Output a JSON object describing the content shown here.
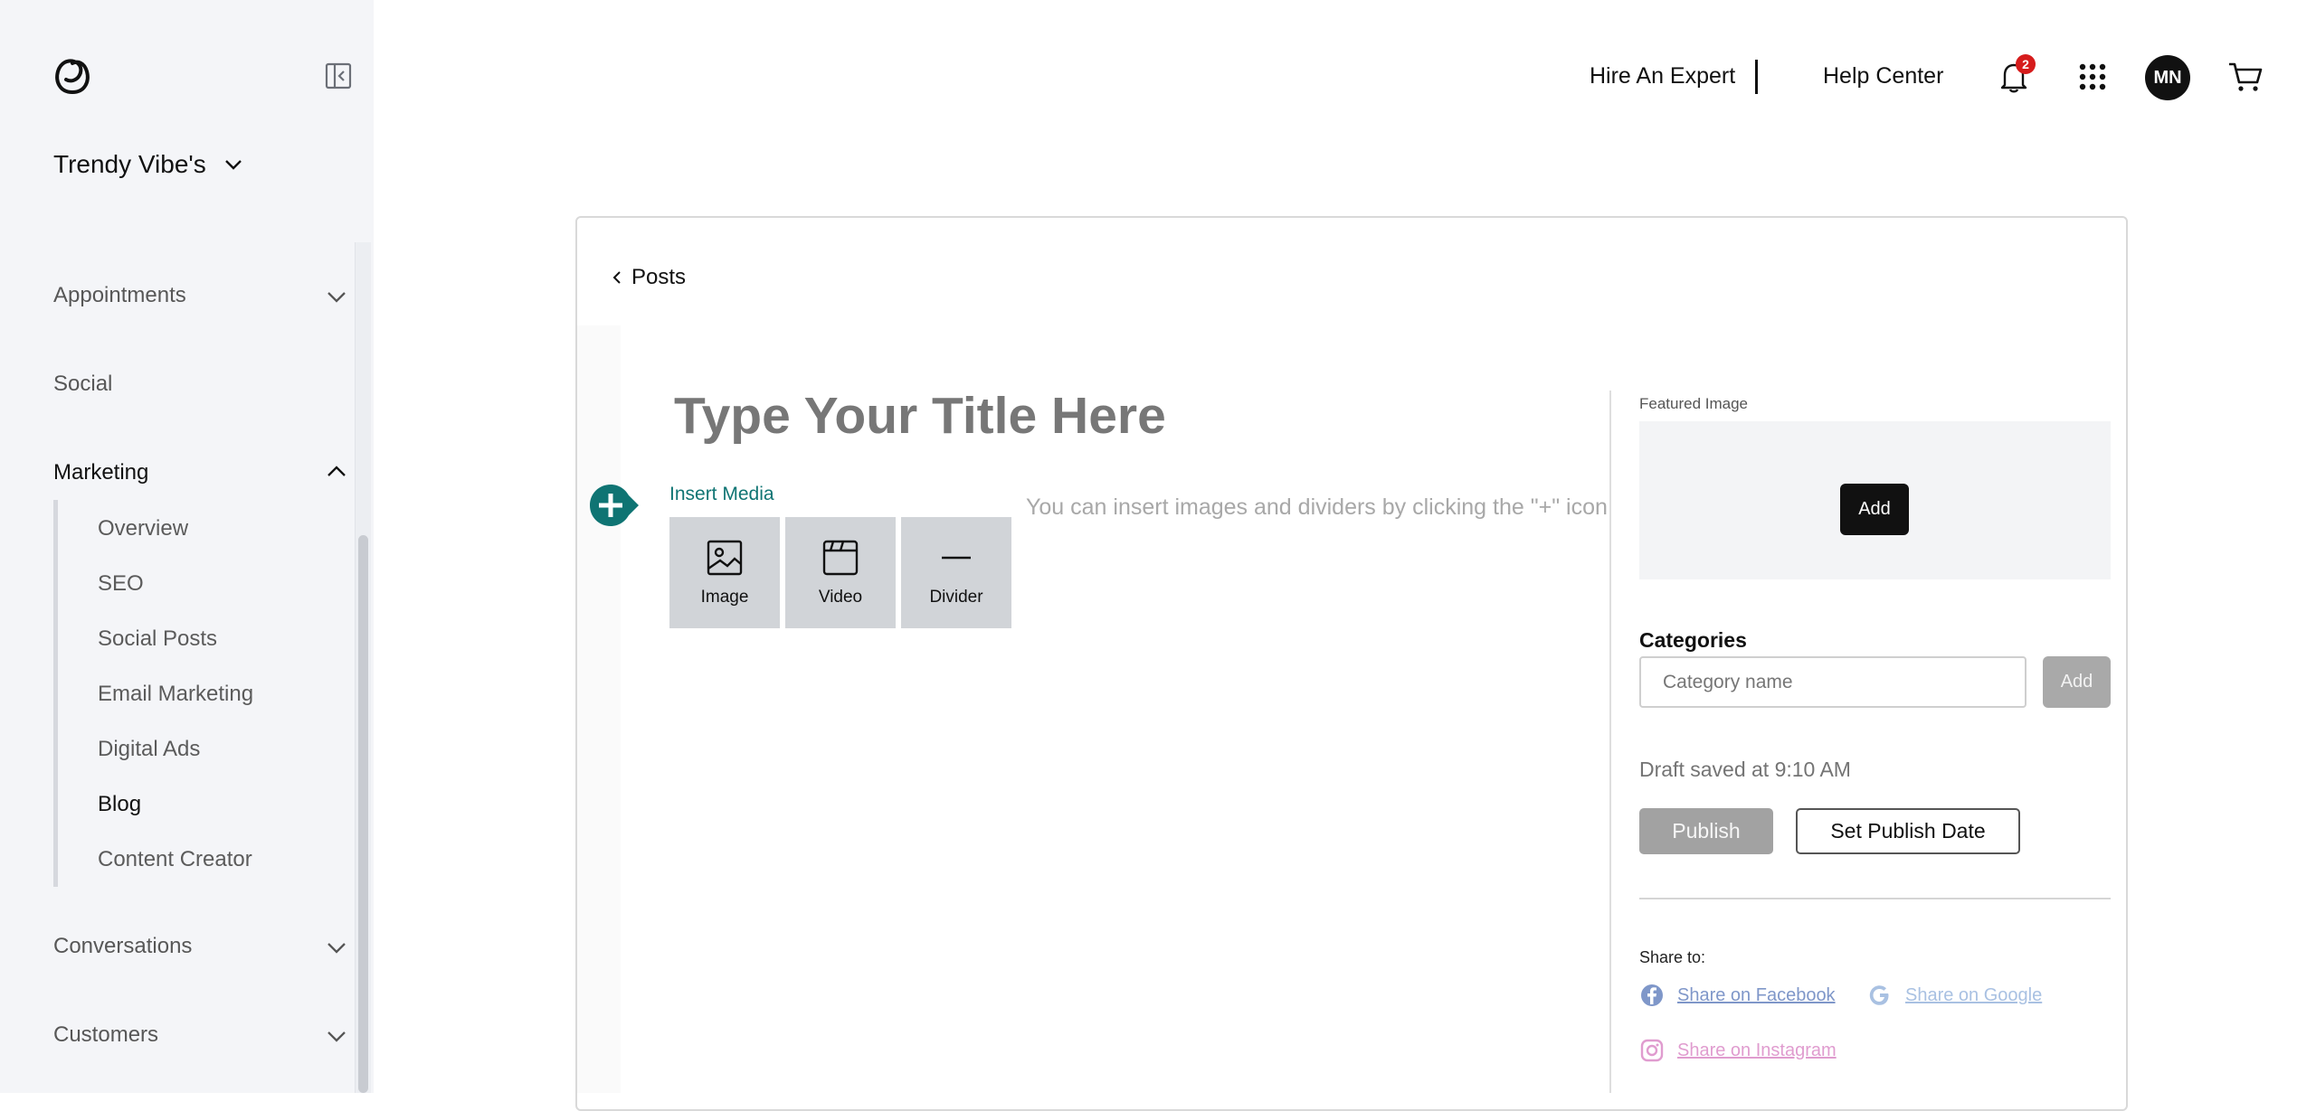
{
  "sidebar": {
    "site_name": "Trendy Vibe's",
    "nav": [
      {
        "label": "Appointments"
      },
      {
        "label": "Social"
      },
      {
        "label": "Marketing"
      },
      {
        "label": "Conversations"
      },
      {
        "label": "Customers"
      }
    ],
    "marketing_sub": [
      {
        "label": "Overview"
      },
      {
        "label": "SEO"
      },
      {
        "label": "Social Posts"
      },
      {
        "label": "Email Marketing"
      },
      {
        "label": "Digital Ads"
      },
      {
        "label": "Blog"
      },
      {
        "label": "Content Creator"
      }
    ]
  },
  "topbar": {
    "hire_expert": "Hire An Expert",
    "help_center": "Help Center",
    "notification_count": "2",
    "avatar_initials": "MN"
  },
  "editor": {
    "back_label": "Posts",
    "title_placeholder": "Type Your Title Here",
    "insert_media_label": "Insert Media",
    "media_buttons": [
      {
        "label": "Image",
        "icon": "image-icon"
      },
      {
        "label": "Video",
        "icon": "video-icon"
      },
      {
        "label": "Divider",
        "icon": "divider-icon"
      }
    ],
    "body_hint": "You can insert images and dividers by clicking the \"+\" icon",
    "accent_color": "#0f7473"
  },
  "panel": {
    "featured_image_label": "Featured Image",
    "featured_add": "Add",
    "categories_label": "Categories",
    "category_placeholder": "Category name",
    "category_add": "Add",
    "draft_status": "Draft saved at 9:10 AM",
    "publish": "Publish",
    "set_publish_date": "Set Publish Date",
    "share_label": "Share to:",
    "share_facebook": "Share on Facebook",
    "share_google": "Share on Google",
    "share_instagram": "Share on Instagram"
  }
}
